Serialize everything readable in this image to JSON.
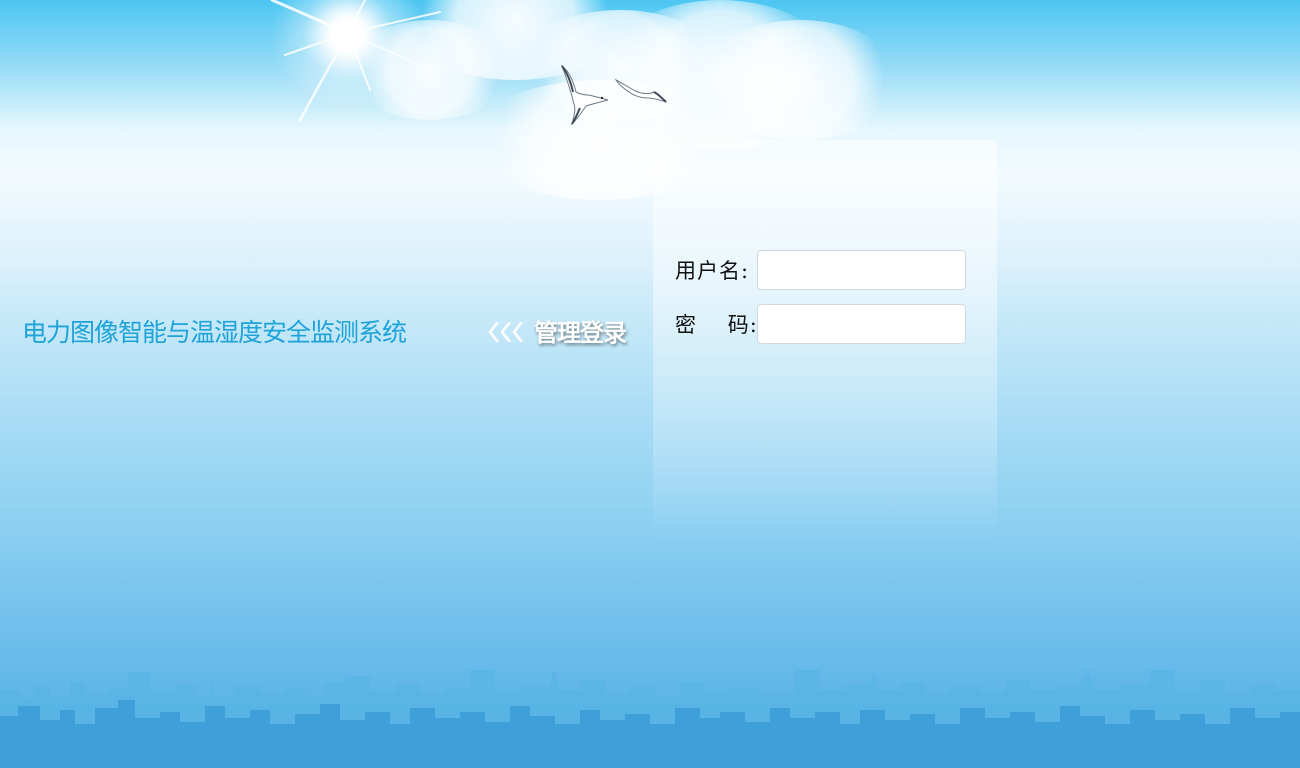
{
  "header": {
    "system_title": "电力图像智能与温湿度安全监测系统",
    "login_heading": "管理登录",
    "title_color": "#1ea3d9"
  },
  "login_form": {
    "username_label": "用户名:",
    "username_value": "",
    "password_label": "密    码:",
    "password_value": ""
  },
  "decorations": {
    "sun": "sun-icon",
    "birds": [
      "seagull-icon",
      "seagull-icon"
    ],
    "skyline": "city-skyline",
    "chevron": "double-chevron-left-icon"
  },
  "colors": {
    "sky_top": "#4cc6f2",
    "sky_bottom": "#55addf",
    "skyline": "#3f9fd8"
  }
}
